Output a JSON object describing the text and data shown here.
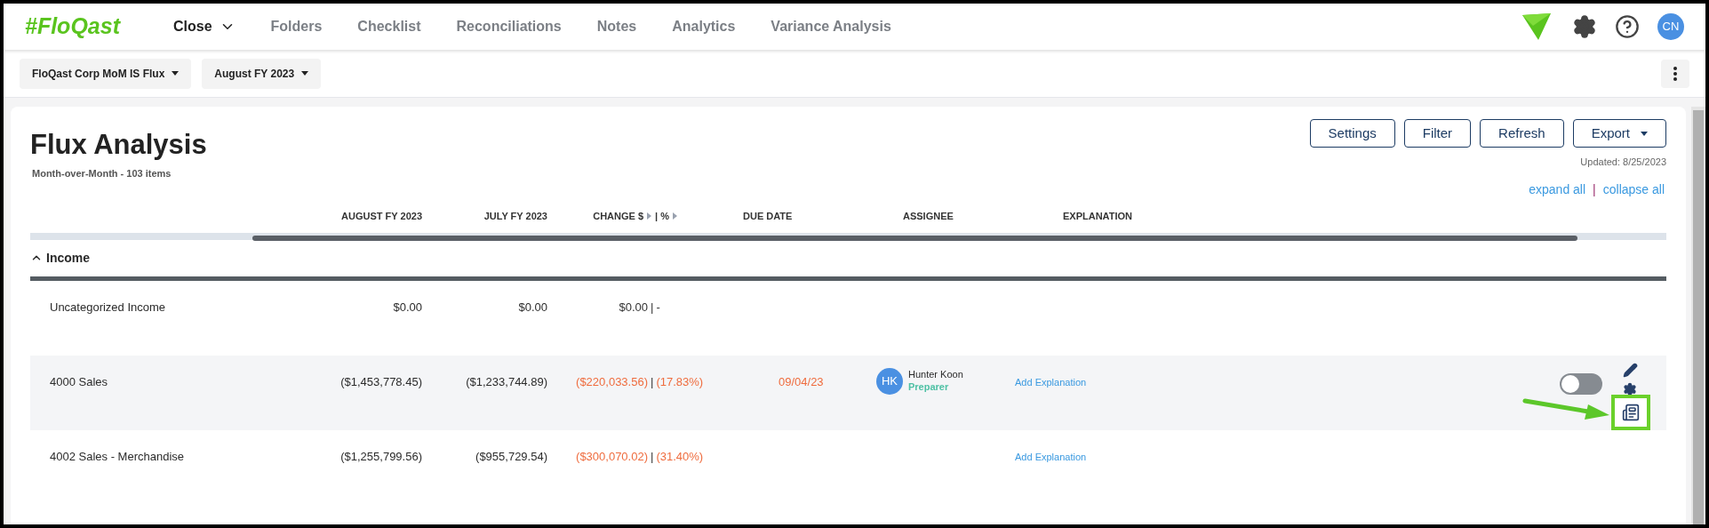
{
  "nav": {
    "logo": "#FloQast",
    "items": [
      {
        "label": "Close",
        "selected": true,
        "has_caret": true
      },
      {
        "label": "Folders",
        "selected": false,
        "has_caret": false
      },
      {
        "label": "Checklist",
        "selected": false,
        "has_caret": false
      },
      {
        "label": "Reconciliations",
        "selected": false,
        "has_caret": false
      },
      {
        "label": "Notes",
        "selected": false,
        "has_caret": false
      },
      {
        "label": "Analytics",
        "selected": false,
        "has_caret": false
      },
      {
        "label": "Variance Analysis",
        "selected": false,
        "has_caret": false
      }
    ],
    "avatar": "CN"
  },
  "filters": [
    "FloQast Corp MoM IS Flux",
    "August FY 2023"
  ],
  "page": {
    "title": "Flux Analysis",
    "subtitle": "Month-over-Month - 103 items",
    "buttons": [
      {
        "label": "Settings",
        "dropdown": false
      },
      {
        "label": "Filter",
        "dropdown": false
      },
      {
        "label": "Refresh",
        "dropdown": false
      },
      {
        "label": "Export",
        "dropdown": true
      }
    ],
    "updated": "Updated: 8/25/2023",
    "expand_all": "expand all",
    "separator": "|",
    "collapse_all": "collapse all"
  },
  "table": {
    "columns": [
      "AUGUST FY 2023",
      "JULY FY 2023",
      "CHANGE $",
      "| %",
      "DUE DATE",
      "ASSIGNEE",
      "EXPLANATION"
    ],
    "group": {
      "label": "Income",
      "expanded": true
    },
    "rows": [
      {
        "name": "Uncategorized Income",
        "aug": "$0.00",
        "jul": "$0.00",
        "change": "$0.00",
        "sep": "|",
        "pct": "-",
        "flagged": false,
        "due": null,
        "assignee": null,
        "explanation": null,
        "selected": false
      },
      {
        "name": "4000 Sales",
        "aug": "($1,453,778.45)",
        "jul": "($1,233,744.89)",
        "change": "($220,033.56)",
        "sep": "|",
        "pct": "(17.83%)",
        "flagged": true,
        "due": "09/04/23",
        "assignee": {
          "initials": "HK",
          "name": "Hunter Koon",
          "role": "Preparer"
        },
        "explanation": "Add Explanation",
        "selected": true,
        "toggle_on": false
      },
      {
        "name": "4002 Sales - Merchandise",
        "aug": "($1,255,799.56)",
        "jul": "($955,729.54)",
        "change": "($300,070.02)",
        "sep": "|",
        "pct": "(31.40%)",
        "flagged": true,
        "due": null,
        "assignee": null,
        "explanation": "Add Explanation",
        "selected": false
      }
    ]
  }
}
